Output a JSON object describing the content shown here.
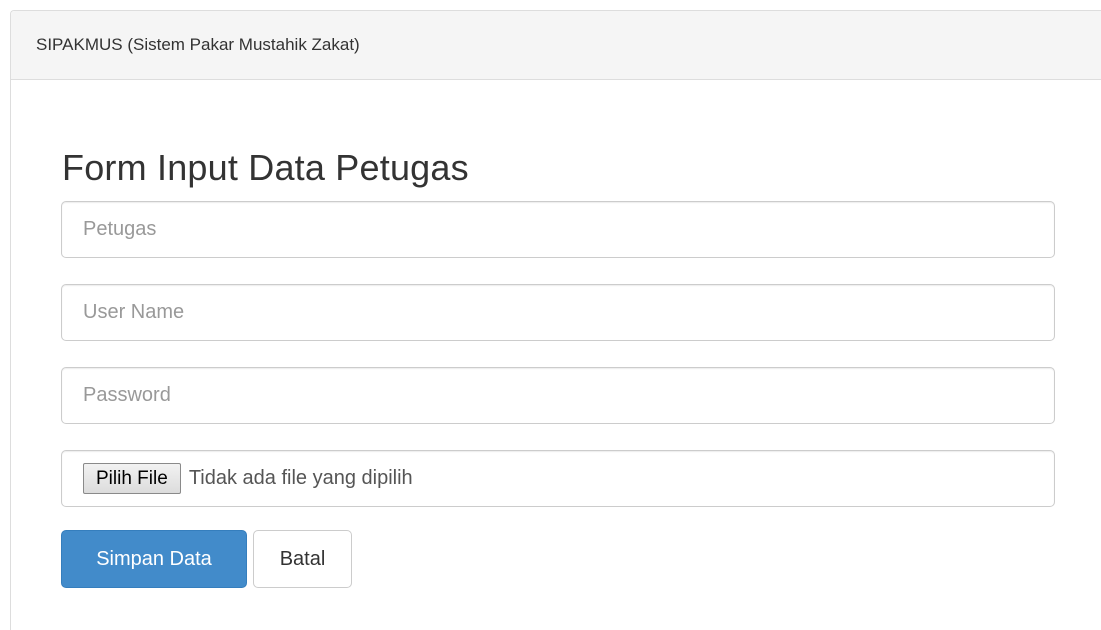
{
  "app": {
    "title": "SIPAKMUS (Sistem Pakar Mustahik Zakat)"
  },
  "form": {
    "title": "Form Input Data Petugas",
    "fields": {
      "petugas": {
        "value": "",
        "placeholder": "Petugas"
      },
      "username": {
        "value": "",
        "placeholder": "User Name"
      },
      "password": {
        "value": "",
        "placeholder": "Password"
      }
    },
    "file": {
      "button_label": "Pilih File",
      "status": "Tidak ada file yang dipilih"
    },
    "buttons": {
      "save_label": "Simpan Data",
      "cancel_label": "Batal"
    }
  },
  "colors": {
    "primary": "#428bca",
    "heading_bg": "#f5f5f5",
    "border": "#cccccc"
  }
}
